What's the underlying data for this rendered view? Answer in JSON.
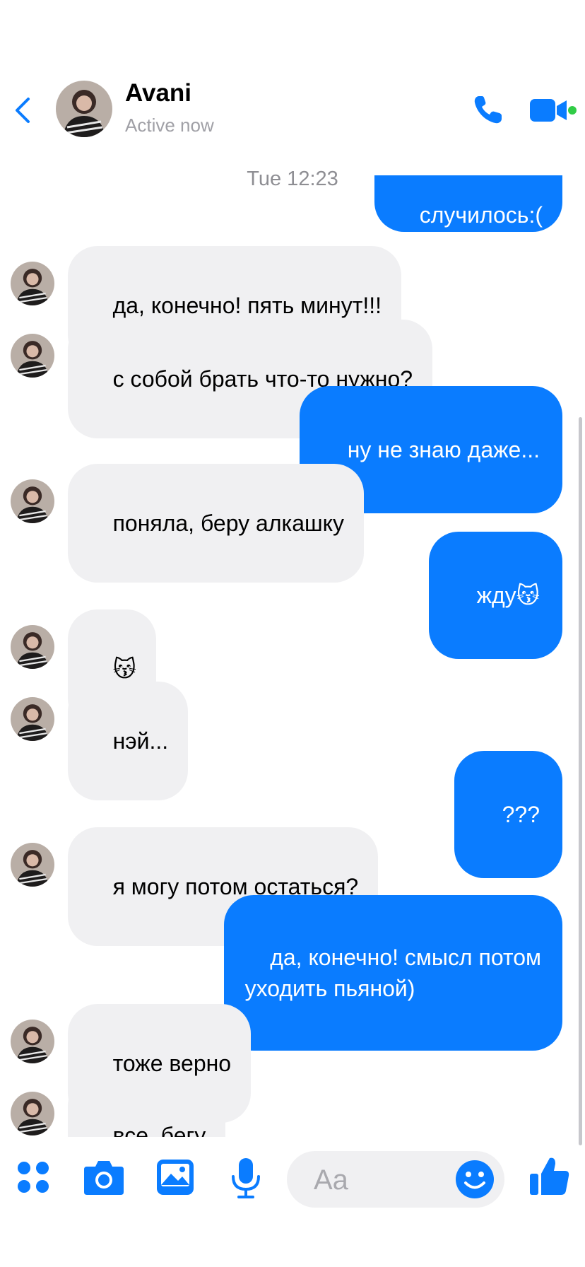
{
  "header": {
    "contact_name": "Avani",
    "status": "Active now"
  },
  "timestamp": "Tue 12:23",
  "messages": [
    {
      "dir": "out",
      "text": "случилось:("
    },
    {
      "dir": "in",
      "text": "да, конечно! пять минут!!!"
    },
    {
      "dir": "in",
      "text": "с собой брать что-то нужно?"
    },
    {
      "dir": "out",
      "text": "ну не знаю даже..."
    },
    {
      "dir": "in",
      "text": "поняла, беру алкашку"
    },
    {
      "dir": "out",
      "text": "жду😽"
    },
    {
      "dir": "in",
      "text": "😽"
    },
    {
      "dir": "in",
      "text": "нэй..."
    },
    {
      "dir": "out",
      "text": "???"
    },
    {
      "dir": "in",
      "text": "я могу потом остаться?"
    },
    {
      "dir": "out",
      "text": "да, конечно! смысл потом\nуходить пьяной)"
    },
    {
      "dir": "in",
      "text": "тоже верно"
    },
    {
      "dir": "in",
      "text": "все, бегу"
    }
  ],
  "composer": {
    "placeholder": "Aa"
  },
  "icons": {
    "back": "chevron-left-icon",
    "call": "phone-icon",
    "video": "video-camera-icon",
    "apps": "four-dots-icon",
    "camera": "camera-icon",
    "gallery": "image-icon",
    "mic": "microphone-icon",
    "emoji": "smiley-icon",
    "like": "thumbs-up-icon"
  },
  "colors": {
    "accent": "#0a7cff",
    "incoming_bubble": "#f0f0f2",
    "online_dot": "#31cc46"
  }
}
